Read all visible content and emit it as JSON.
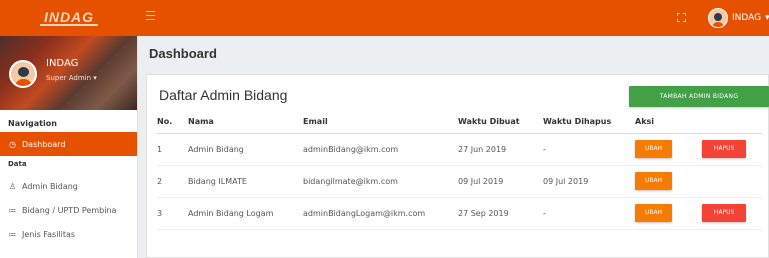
{
  "topbar": {
    "logo_text": "INDAG",
    "menu_icon": "hamburger-icon",
    "fullscreen_icon": "fullscreen-icon",
    "user_label": "INDAG",
    "user_caret": "▾",
    "accent": "#e65100"
  },
  "sidebar": {
    "profile": {
      "name": "INDAG",
      "role": "Super Admin ▾"
    },
    "nav_header": "Navigation",
    "items": [
      {
        "icon": "◷",
        "label": "Dashboard",
        "active": true
      }
    ],
    "section": "Data",
    "data_items": [
      {
        "icon": "♙",
        "label": "Admin Bidang"
      },
      {
        "icon": "≔",
        "label": "Bidang / UPTD Pembina"
      },
      {
        "icon": "≔",
        "label": "Jenis Fasilitas"
      }
    ]
  },
  "page_title": "Dashboard",
  "card": {
    "title": "Daftar Admin Bidang",
    "add_button": "TAMBAH ADMIN BIDANG",
    "columns": [
      "No.",
      "Nama",
      "Email",
      "Waktu Dibuat",
      "Waktu Dihapus",
      "Aksi"
    ],
    "rows": [
      {
        "no": "1",
        "nama": "Admin Bidang",
        "email": "adminBidang@ikm.com",
        "dibuat": "27 Jun 2019",
        "dihapus": "-",
        "ubah": "UBAH",
        "hapus": "HAPUS"
      },
      {
        "no": "2",
        "nama": "Bidang ILMATE",
        "email": "bidangilmate@ikm.com",
        "dibuat": "09 Jul 2019",
        "dihapus": "09 Jul 2019",
        "ubah": "UBAH",
        "hapus": ""
      },
      {
        "no": "3",
        "nama": "Admin Bidang Logam",
        "email": "adminBidangLogam@ikm.com",
        "dibuat": "27 Sep 2019",
        "dihapus": "-",
        "ubah": "UBAH",
        "hapus": "HAPUS"
      }
    ]
  }
}
